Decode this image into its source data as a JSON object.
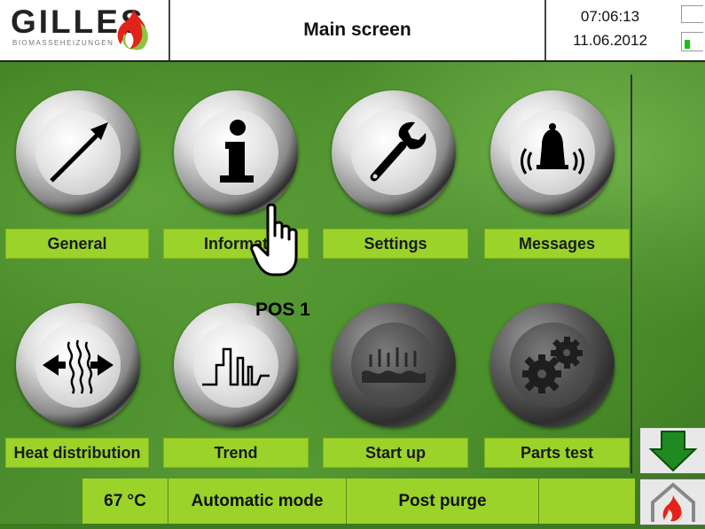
{
  "header": {
    "logo_text": "GILLES",
    "logo_subtext": "BIOMASSEHEIZUNGEN",
    "title": "Main screen",
    "time": "07:06:13",
    "date": "11.06.2012"
  },
  "menu": [
    {
      "label": "General",
      "icon": "arrow-icon"
    },
    {
      "label": "Informat",
      "icon": "info-icon"
    },
    {
      "label": "Settings",
      "icon": "wrench-icon"
    },
    {
      "label": "Messages",
      "icon": "bell-icon"
    },
    {
      "label": "Heat distribution",
      "icon": "heat-distribution-icon"
    },
    {
      "label": "Trend",
      "icon": "trend-icon"
    },
    {
      "label": "Start up",
      "icon": "start-up-icon"
    },
    {
      "label": "Parts test",
      "icon": "gears-icon"
    }
  ],
  "overlay": {
    "pos_label": "POS 1"
  },
  "status": {
    "temperature": "67 °C",
    "mode": "Automatic mode",
    "phase": "Post purge",
    "extra": ""
  },
  "colors": {
    "label_bg": "#9bd32a",
    "indicator": "#16c21a"
  }
}
